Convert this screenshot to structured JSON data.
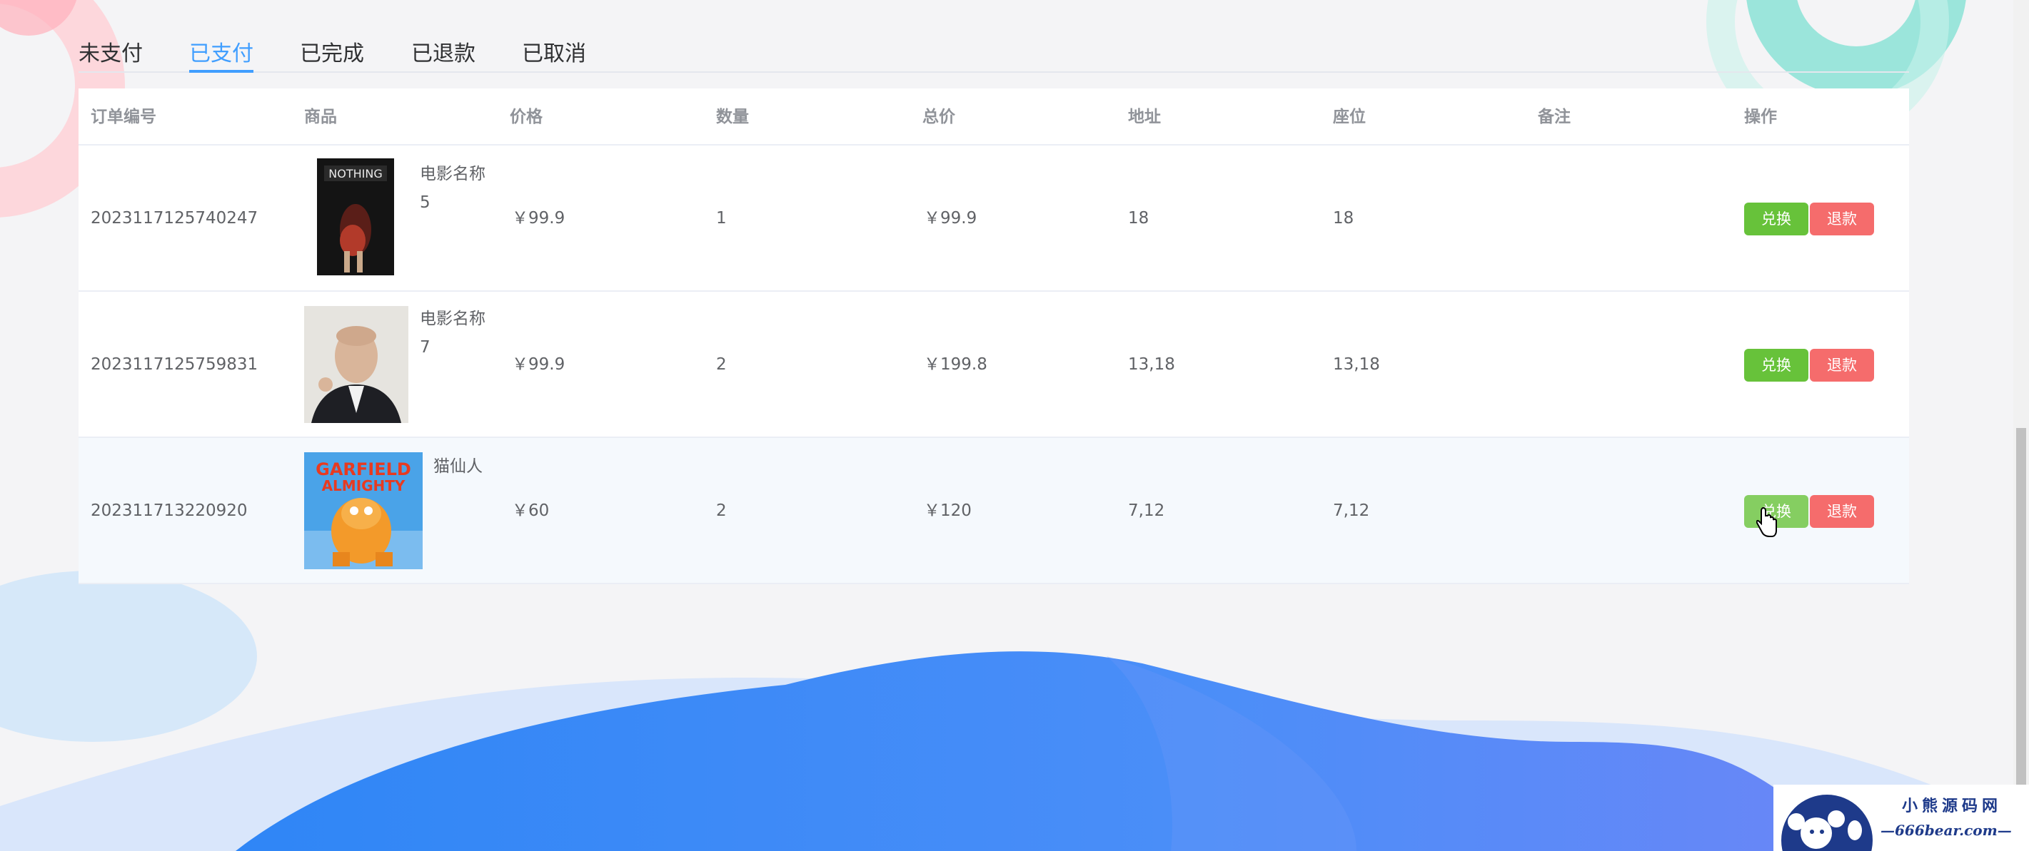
{
  "tabs": [
    {
      "label": "未支付"
    },
    {
      "label": "已支付"
    },
    {
      "label": "已完成"
    },
    {
      "label": "已退款"
    },
    {
      "label": "已取消"
    }
  ],
  "active_tab": "已支付",
  "table": {
    "headers": {
      "order_no": "订单编号",
      "product": "商品",
      "price": "价格",
      "quantity": "数量",
      "total": "总价",
      "address": "地址",
      "seat": "座位",
      "remark": "备注",
      "actions": "操作"
    },
    "rows": [
      {
        "order_no": "2023117125740247",
        "product_name": "电影名称\n5",
        "price": "￥99.9",
        "quantity": "1",
        "total": "￥99.9",
        "address": "18",
        "seat": "18",
        "remark": ""
      },
      {
        "order_no": "2023117125759831",
        "product_name": "电影名称\n7",
        "price": "￥99.9",
        "quantity": "2",
        "total": "￥199.8",
        "address": "13,18",
        "seat": "13,18",
        "remark": ""
      },
      {
        "order_no": "202311713220920",
        "product_name": "猫仙人",
        "price": "￥60",
        "quantity": "2",
        "total": "￥120",
        "address": "7,12",
        "seat": "7,12",
        "remark": ""
      }
    ],
    "redeem_label": "兑换",
    "refund_label": "退款"
  },
  "watermark": {
    "title": "小熊源码网",
    "subtitle": "—666bear.com—"
  },
  "colors": {
    "accent": "#409eff",
    "redeem": "#67c23a",
    "refund": "#f56c6c",
    "wave": "#3f8cf8"
  },
  "poster_icons": [
    "movie-poster-dark",
    "portrait-man-suit",
    "garfield-poster"
  ]
}
